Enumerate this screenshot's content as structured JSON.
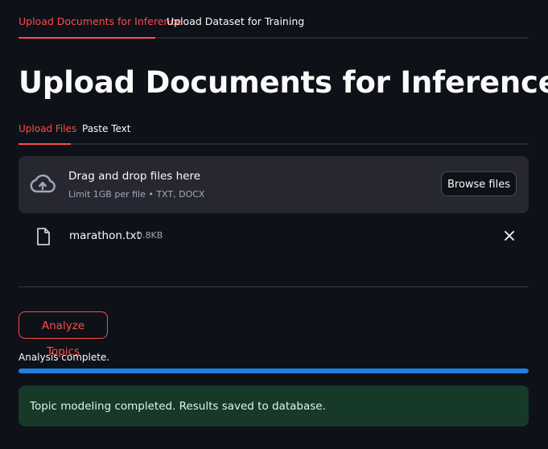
{
  "tabs": [
    {
      "label": "Upload Documents for Inference",
      "active": true
    },
    {
      "label": "Upload Dataset for Training",
      "active": false
    }
  ],
  "page_title": "Upload Documents for Inference",
  "subtabs": [
    {
      "label": "Upload Files",
      "active": true
    },
    {
      "label": "Paste Text",
      "active": false
    }
  ],
  "uploader": {
    "title": "Drag and drop files here",
    "limit": "Limit 1GB per file • TXT, DOCX",
    "browse_label": "Browse files",
    "icon": "cloud-upload-icon"
  },
  "file": {
    "name": "marathon.txt",
    "size": "0.8KB",
    "icon": "file-icon",
    "remove_icon": "close-icon"
  },
  "analyze_label": "Analyze Topics",
  "progress": {
    "label": "Analysis complete.",
    "value": 1.0
  },
  "success_message": "Topic modeling completed. Results saved to database.",
  "colors": {
    "background": "#0e1117",
    "accent": "#ff4b4b",
    "progress": "#1c83e1",
    "success_bg": "#173928",
    "panel": "#262730"
  }
}
